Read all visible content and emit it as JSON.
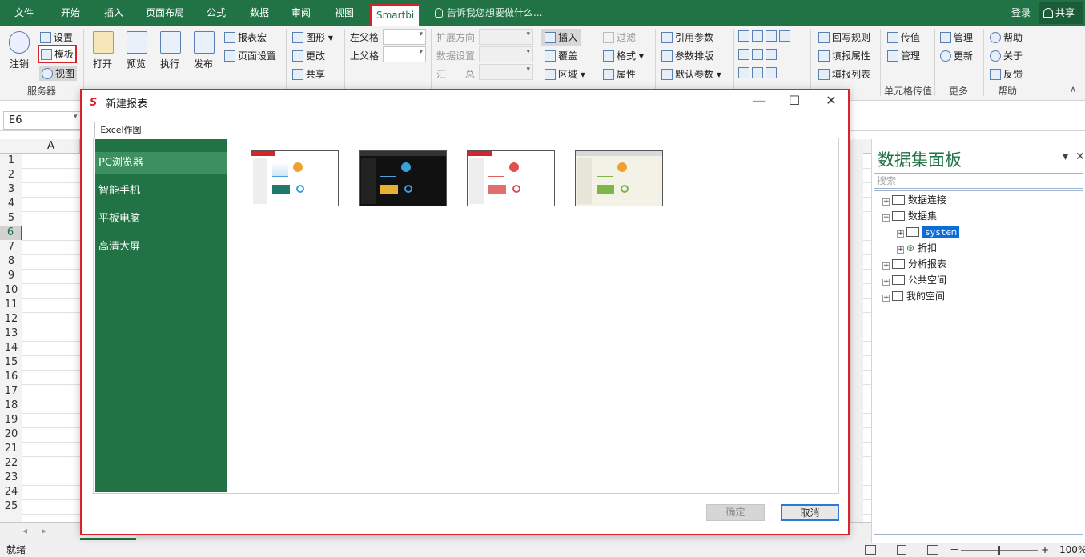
{
  "tabs": [
    "文件",
    "开始",
    "插入",
    "页面布局",
    "公式",
    "数据",
    "审阅",
    "视图",
    "Smartbi"
  ],
  "tell_me": "告诉我您想要做什么...",
  "login": "登录",
  "share": "共享",
  "ribbon": {
    "logout": "注销",
    "settings": "设置",
    "template": "模板",
    "view": "视图",
    "server_group": "服务器",
    "open": "打开",
    "preview": "预览",
    "execute": "执行",
    "publish": "发布",
    "report_macro": "报表宏",
    "page_setup": "页面设置",
    "graph": "图形",
    "change": "更改",
    "share": "共享",
    "left_parent": "左父格",
    "top_parent": "上父格",
    "expand_dir": "扩展方向",
    "data_setting": "数据设置",
    "summary": "汇　　总",
    "insert": "插入",
    "cover": "覆盖",
    "area": "区域",
    "filter": "过滤",
    "format": "格式",
    "attribute": "属性",
    "ref_param": "引用参数",
    "param_layout": "参数排版",
    "default_param": "默认参数",
    "writeback_rule": "回写规则",
    "fill_attr": "填报属性",
    "fill_list": "填报列表",
    "pass_value": "传值",
    "manage": "管理",
    "cell_pass_group": "单元格传值",
    "manage2": "管理",
    "update": "更新",
    "more_group": "更多",
    "help": "帮助",
    "about": "关于",
    "feedback": "反馈",
    "help_group": "帮助"
  },
  "name_box": "E6",
  "column_a": "A",
  "rows": [
    "1",
    "2",
    "3",
    "4",
    "5",
    "6",
    "7",
    "8",
    "9",
    "10",
    "11",
    "12",
    "13",
    "14",
    "15",
    "16",
    "17",
    "18",
    "19",
    "20",
    "21",
    "22",
    "23",
    "24",
    "25"
  ],
  "status": "就绪",
  "zoom": "100%",
  "panel": {
    "title": "数据集面板",
    "search_placeholder": "搜索",
    "tree": [
      "数据连接",
      "数据集",
      "system",
      "折扣",
      "分析报表",
      "公共空间",
      "我的空间"
    ]
  },
  "dialog": {
    "title": "新建报表",
    "tab": "Excel作图",
    "categories": [
      "PC浏览器",
      "智能手机",
      "平板电脑",
      "高清大屏"
    ],
    "ok": "确定",
    "cancel": "取消"
  },
  "colors": {
    "excel_green": "#217346",
    "highlight_red": "#d9232b"
  }
}
